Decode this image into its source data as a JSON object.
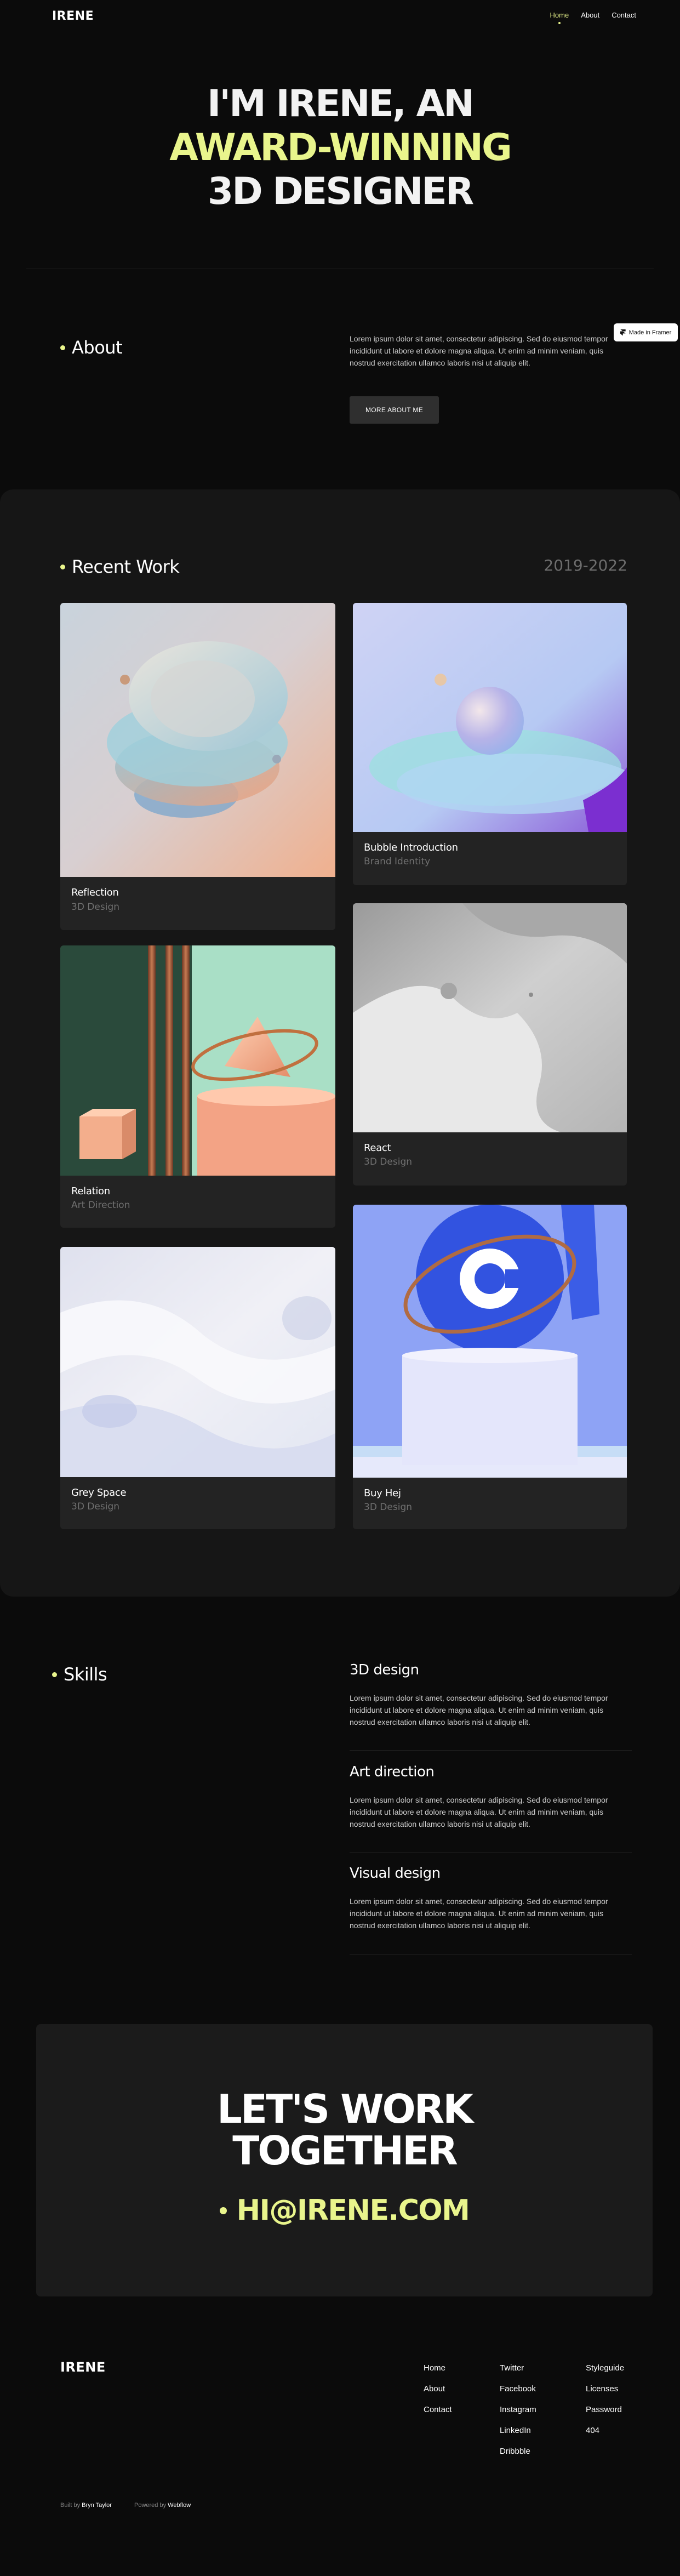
{
  "brand": "IRENE",
  "nav": {
    "items": [
      {
        "label": "Home",
        "active": true
      },
      {
        "label": "About",
        "active": false
      },
      {
        "label": "Contact",
        "active": false
      }
    ]
  },
  "hero": {
    "line1": "I'M IRENE, AN",
    "line2": "AWARD-WINNING",
    "line3": "3D DESIGNER"
  },
  "about": {
    "title": "About",
    "text": "Lorem ipsum dolor sit amet, consectetur adipiscing. Sed do eiusmod tempor incididunt ut labore et dolore magna aliqua. Ut enim ad minim veniam, quis nostrud exercitation ullamco laboris nisi ut aliquip elit.",
    "button": "MORE ABOUT ME"
  },
  "framer_badge": "Made in Framer",
  "work": {
    "title": "Recent Work",
    "years": "2019-2022",
    "projects": [
      {
        "title": "Reflection",
        "category": "3D Design"
      },
      {
        "title": "Bubble Introduction",
        "category": "Brand Identity"
      },
      {
        "title": "Relation",
        "category": "Art Direction"
      },
      {
        "title": "React",
        "category": "3D Design"
      },
      {
        "title": "Grey Space",
        "category": "3D Design"
      },
      {
        "title": "Buy Hej",
        "category": "3D Design"
      }
    ]
  },
  "skills": {
    "title": "Skills",
    "items": [
      {
        "title": "3D design",
        "text": "Lorem ipsum dolor sit amet, consectetur adipiscing. Sed do eiusmod tempor incididunt ut labore et dolore magna aliqua. Ut enim ad minim veniam, quis nostrud exercitation ullamco laboris nisi ut aliquip elit."
      },
      {
        "title": "Art direction",
        "text": "Lorem ipsum dolor sit amet, consectetur adipiscing. Sed do eiusmod tempor incididunt ut labore et dolore magna aliqua. Ut enim ad minim veniam, quis nostrud exercitation ullamco laboris nisi ut aliquip elit."
      },
      {
        "title": "Visual design",
        "text": "Lorem ipsum dolor sit amet, consectetur adipiscing. Sed do eiusmod tempor incididunt ut labore et dolore magna aliqua. Ut enim ad minim veniam, quis nostrud exercitation ullamco laboris nisi ut aliquip elit."
      }
    ]
  },
  "cta": {
    "line1": "LET'S WORK",
    "line2": "TOGETHER",
    "email": "HI@IRENE.COM"
  },
  "footer": {
    "col1": [
      "Home",
      "About",
      "Contact"
    ],
    "col2": [
      "Twitter",
      "Facebook",
      "Instagram",
      "LinkedIn",
      "Dribbble"
    ],
    "col3": [
      "Styleguide",
      "Licenses",
      "Password",
      "404"
    ],
    "built_by_label": "Built by",
    "built_by_name": "Bryn Taylor",
    "powered_label": "Powered by",
    "powered_name": "Webflow"
  },
  "colors": {
    "background": "#0b0b0b",
    "accent": "#e9f58c",
    "panel": "#161616",
    "card": "#232323"
  }
}
